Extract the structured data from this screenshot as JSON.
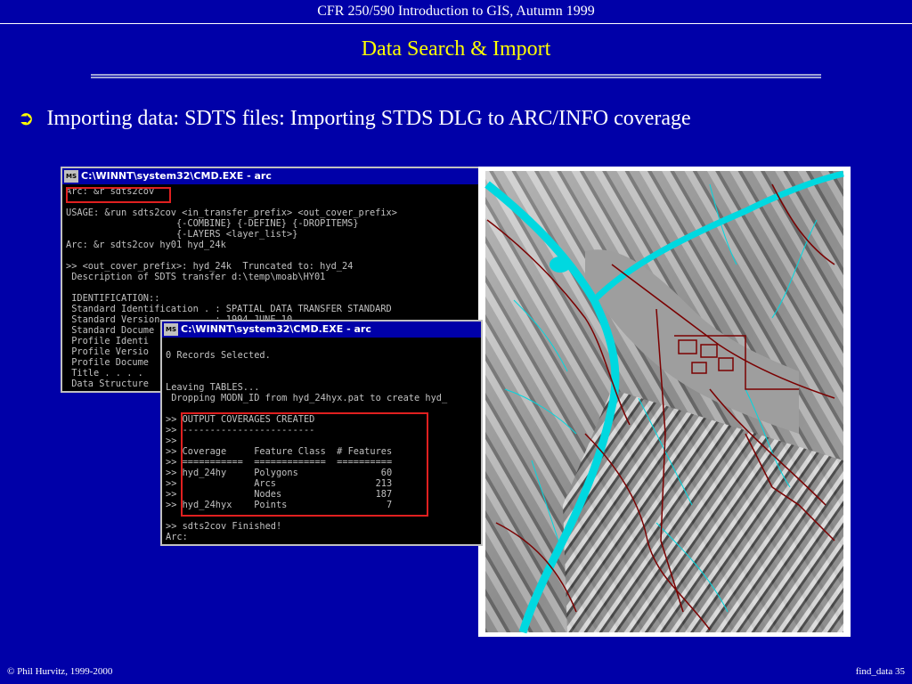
{
  "slide": {
    "header": "CFR 250/590 Introduction to GIS, Autumn 1999",
    "title": "Data Search  & Import",
    "bullet": "Importing data: SDTS files: Importing STDS DLG to ARC/INFO coverage",
    "bullet_icon": "circled-arrow-icon",
    "footer_left": "© Phil Hurvitz, 1999-2000",
    "footer_right": "find_data 35"
  },
  "window1": {
    "title": "C:\\WINNT\\system32\\CMD.EXE - arc",
    "icon_label": "MS",
    "lines": [
      "Arc: &r sdts2cov",
      "",
      "USAGE: &run sdts2cov <in_transfer_prefix> <out_cover_prefix>",
      "                    {-COMBINE} {-DEFINE} {-DROPITEMS}",
      "                    {-LAYERS <layer_list>}",
      "Arc: &r sdts2cov hy01 hyd_24k",
      "",
      ">> <out_cover_prefix>: hyd_24k  Truncated to: hyd_24",
      " Description of SDTS transfer d:\\temp\\moab\\HY01",
      "",
      " IDENTIFICATION::",
      " Standard Identification . : SPATIAL DATA TRANSFER STANDARD",
      " Standard Version          : 1994 JUNE 10",
      " Standard Docume",
      " Profile Identi",
      " Profile Versio",
      " Profile Docume",
      " Title . . . .",
      " Data Structure"
    ]
  },
  "window2": {
    "title": "C:\\WINNT\\system32\\CMD.EXE - arc",
    "icon_label": "MS",
    "lines": [
      "",
      "0 Records Selected.",
      "",
      "",
      "Leaving TABLES...",
      " Dropping MODN_ID from hyd_24hyx.pat to create hyd_",
      "",
      ">> OUTPUT COVERAGES CREATED",
      ">> ------------------------",
      ">>",
      ">> Coverage     Feature Class  # Features",
      ">> ===========  =============  ==========",
      ">> hyd_24hy     Polygons               60",
      ">>              Arcs                  213",
      ">>              Nodes                 187",
      ">> hyd_24hyx    Points                  7",
      "",
      ">> sdts2cov Finished!",
      "Arc:"
    ]
  },
  "map": {
    "alt": "shaded relief map",
    "river_color": "#00D8E0",
    "road_color": "#7A0000",
    "stream_color": "#00D8E0"
  }
}
